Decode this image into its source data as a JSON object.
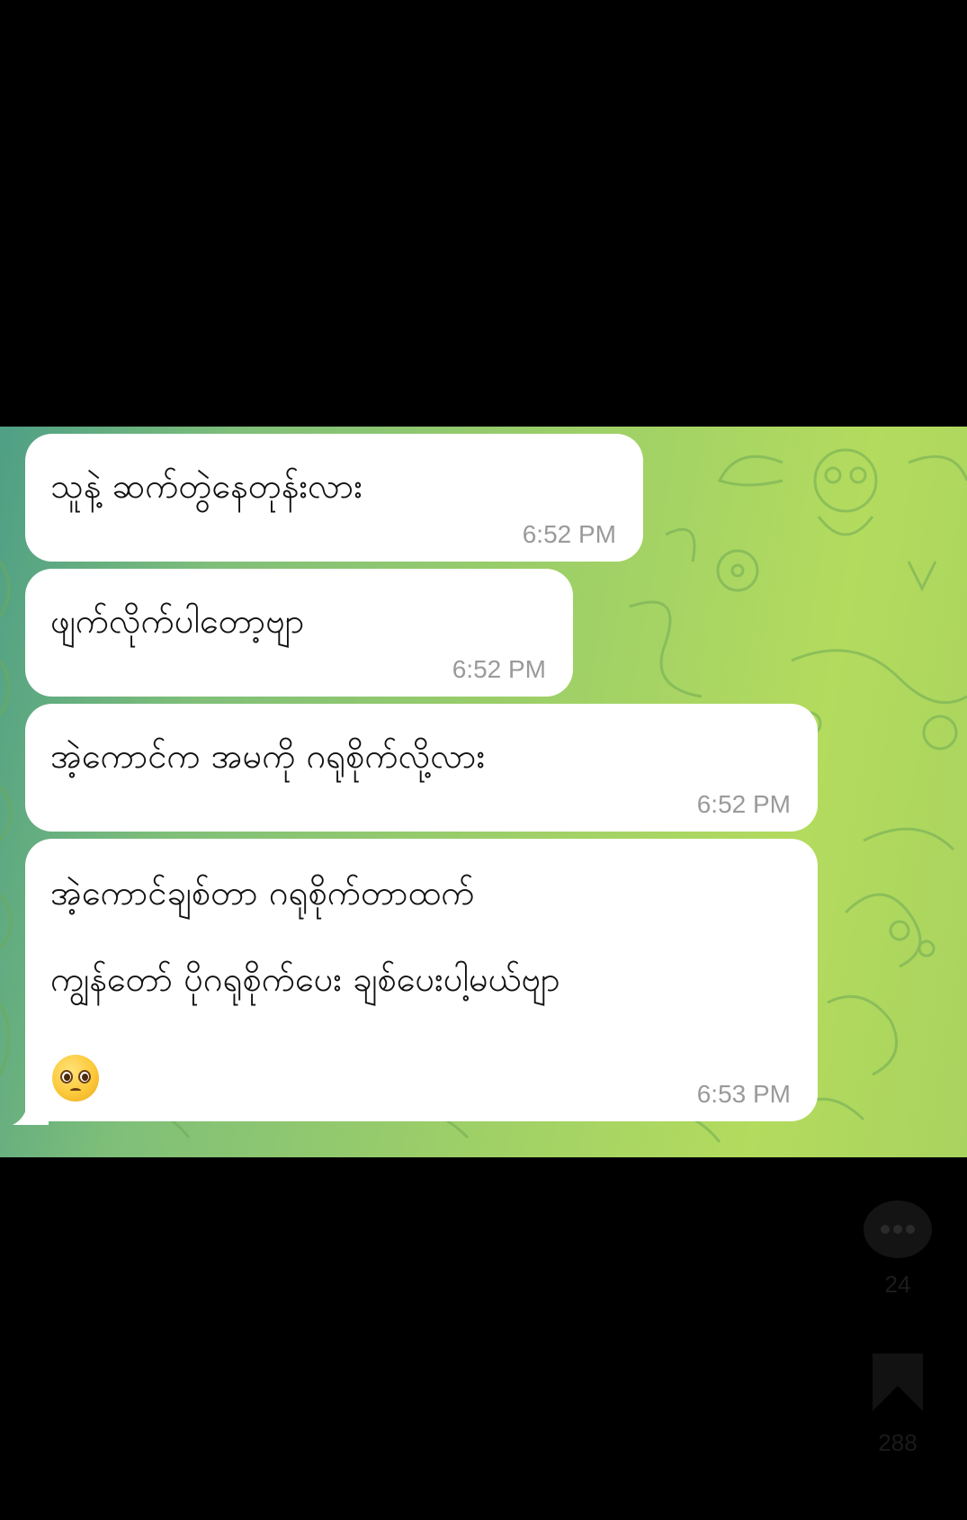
{
  "messages": [
    {
      "text": "သူနဲ့ ဆက်တွဲနေတုန်းလား",
      "time": "6:52 PM"
    },
    {
      "text": "ဖျက်လိုက်ပါတော့ဗျာ",
      "time": "6:52 PM"
    },
    {
      "text": "အဲ့ကောင်က အမကို ဂရုစိုက်လို့လား",
      "time": "6:52 PM"
    },
    {
      "lines": [
        "အဲ့ကောင်ချစ်တာ ဂရုစိုက်တာထက်",
        "ကျွန်တော် ပိုဂရုစိုက်ပေး ချစ်ပေးပါ့မယ်ဗျာ"
      ],
      "emoji": "pleading-face",
      "time": "6:53 PM"
    }
  ],
  "side_actions": {
    "comment_count": "24",
    "bookmark_count": "288"
  },
  "colors": {
    "background": "#000000",
    "chat_wallpaper_start": "#4f9f86",
    "chat_wallpaper_end": "#b3db5e",
    "bubble": "#ffffff",
    "timestamp": "#9a9a9a"
  }
}
